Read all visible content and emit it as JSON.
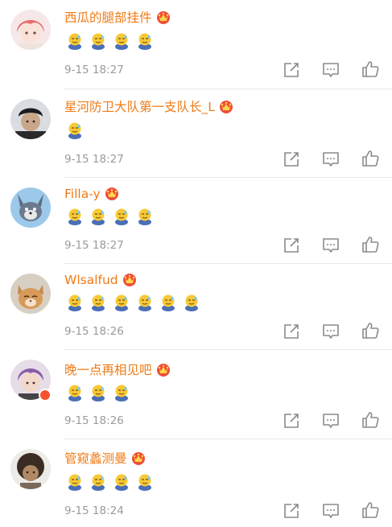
{
  "colors": {
    "username": "#f07b16",
    "time": "#9b9b9b",
    "icon": "#8a8a8a",
    "badge": "#f4522f"
  },
  "comments": [
    {
      "name": "西瓜的腿部挂件",
      "time": "9-15 18:27",
      "emoji_count": 4,
      "avatar": "avatar-pink-hair"
    },
    {
      "name": "星河防卫大队第一支队长_L",
      "time": "9-15 18:27",
      "emoji_count": 1,
      "avatar": "avatar-man-black-cap"
    },
    {
      "name": "Filla-y",
      "time": "9-15 18:27",
      "emoji_count": 4,
      "avatar": "avatar-cartoon-cat"
    },
    {
      "name": "Wlsalfud",
      "time": "9-15 18:26",
      "emoji_count": 6,
      "avatar": "avatar-orange-cat"
    },
    {
      "name": "晚一点再相见吧",
      "time": "9-15 18:26",
      "emoji_count": 3,
      "avatar": "avatar-purple-hair",
      "verified_badge": true
    },
    {
      "name": "管窥蠡测曼",
      "time": "9-15 18:24",
      "emoji_count": 4,
      "avatar": "avatar-curly-hair"
    }
  ],
  "actions": [
    "share-icon",
    "comment-icon",
    "like-icon"
  ]
}
